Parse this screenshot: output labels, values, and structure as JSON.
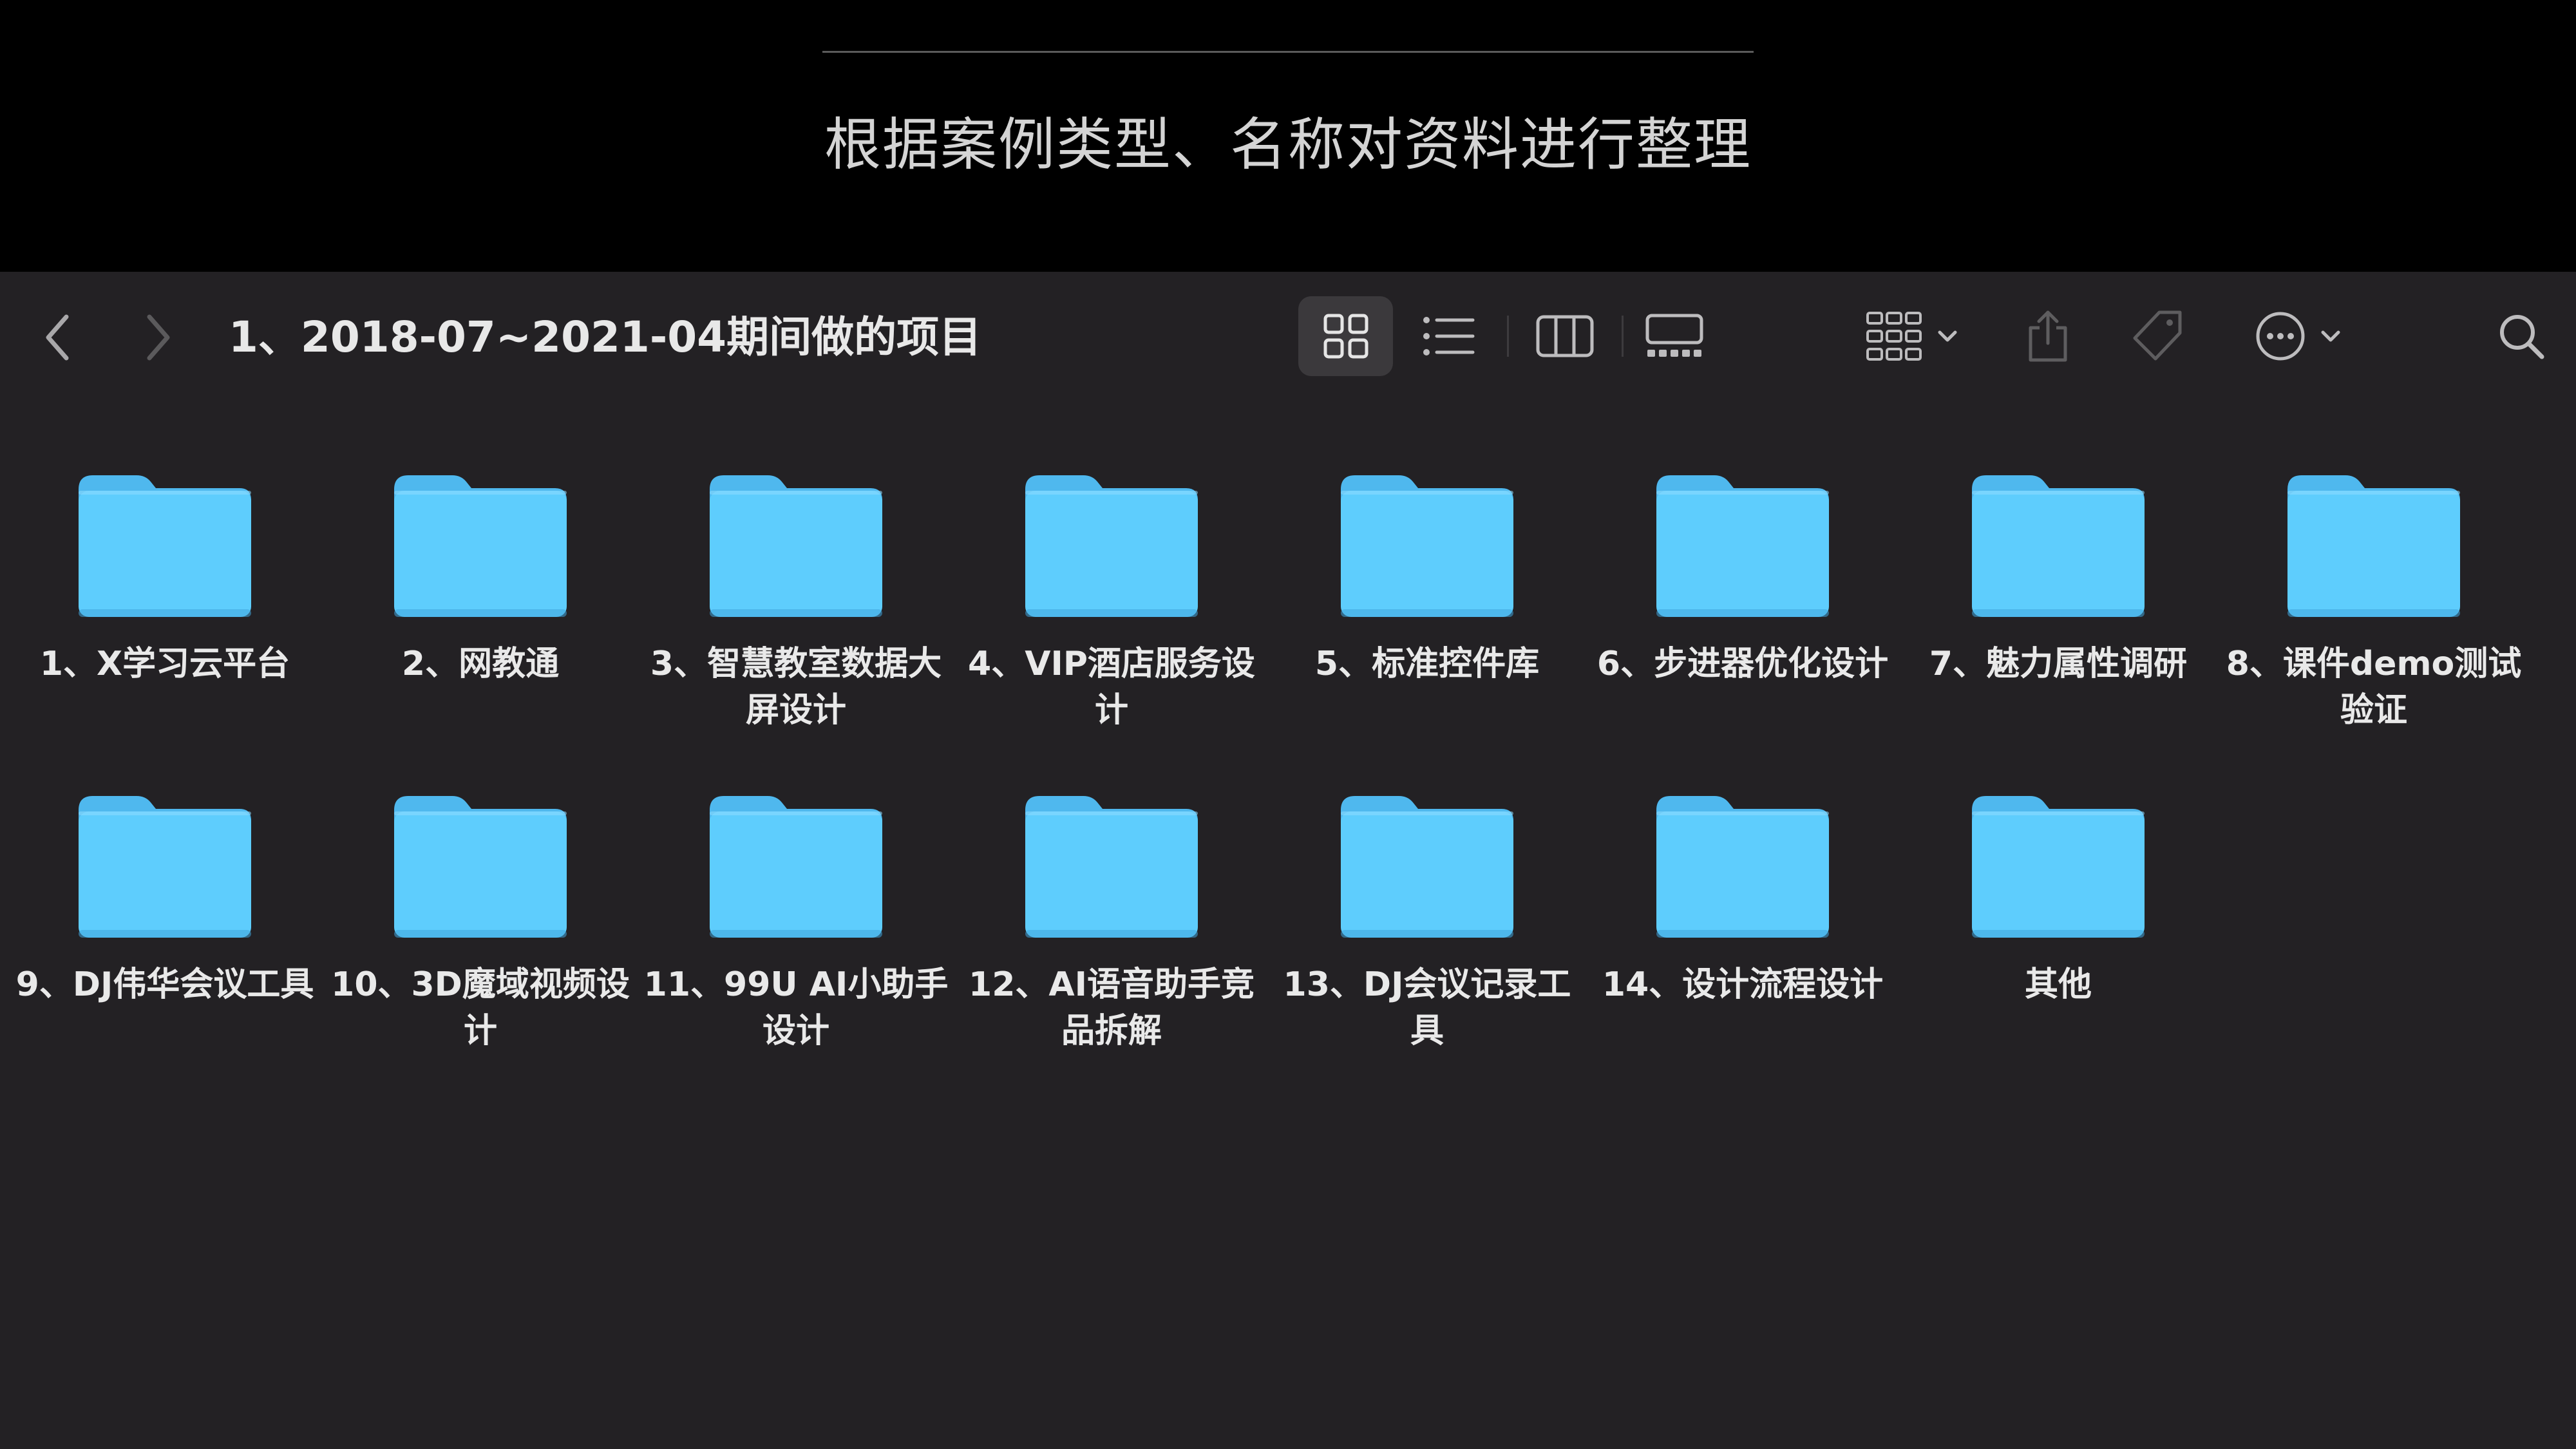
{
  "slide": {
    "caption": "根据案例类型、名称对资料进行整理"
  },
  "window": {
    "title": "1、2018-07~2021-04期间做的项目"
  },
  "colors": {
    "folder": "#5ecdfd",
    "folder_tab": "#4fb8ee",
    "window_bg": "#232124",
    "selected_view_bg": "#3b393c"
  },
  "toolbar": {
    "icons": [
      "chevron-left-icon",
      "chevron-right-icon",
      "icon-view-icon",
      "list-view-icon",
      "column-view-icon",
      "gallery-view-icon",
      "group-icon",
      "share-icon",
      "tag-icon",
      "more-icon",
      "search-icon"
    ],
    "selected_view": "icon"
  },
  "folders": [
    {
      "label": "1、X学习云平台"
    },
    {
      "label": "2、网教通"
    },
    {
      "label": "3、智慧教室数据大屏设计"
    },
    {
      "label": "4、VIP酒店服务设计"
    },
    {
      "label": "5、标准控件库"
    },
    {
      "label": "6、步进器优化设计"
    },
    {
      "label": "7、魅力属性调研"
    },
    {
      "label": "8、课件demo测试验证"
    },
    {
      "label": "9、DJ伟华会议工具"
    },
    {
      "label": "10、3D魔域视频设计"
    },
    {
      "label": "11、99U AI小助手设计"
    },
    {
      "label": "12、AI语音助手竞品拆解"
    },
    {
      "label": "13、DJ会议记录工具"
    },
    {
      "label": "14、设计流程设计"
    },
    {
      "label": "其他"
    }
  ]
}
